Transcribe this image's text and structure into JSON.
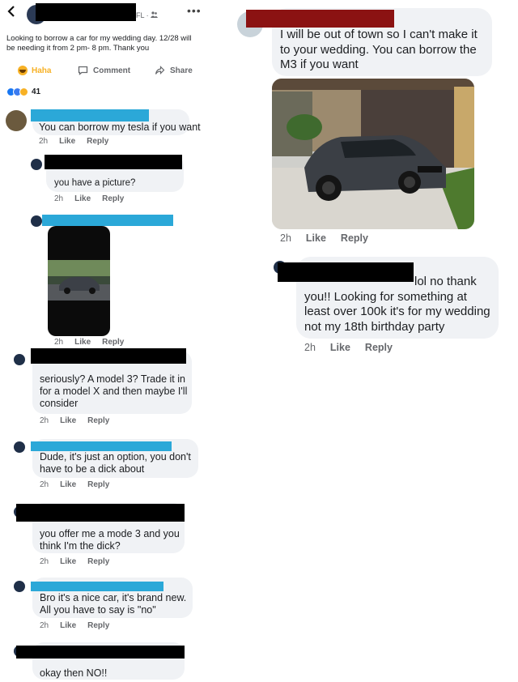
{
  "post": {
    "back_icon": "chevron-left-icon",
    "location": "FL",
    "audience_icon": "friends-icon",
    "more_icon": "more-dots-icon",
    "text": "Looking to borrow a car for my wedding day. 12/28 will\nbe needing it from 2 pm- 8 pm. Thank you",
    "actions": {
      "haha": "Haha",
      "comment": "Comment",
      "share": "Share"
    },
    "reaction_count": "41"
  },
  "comments": [
    {
      "text": "You can borrow my tesla if you want",
      "time": "2h",
      "like": "Like",
      "reply": "Reply"
    },
    {
      "text": "you have a picture?",
      "time": "2h",
      "like": "Like",
      "reply": "Reply"
    },
    {
      "text": "",
      "time": "2h",
      "like": "Like",
      "reply": "Reply"
    },
    {
      "text": "seriously? A model 3? Trade it in\nfor a model X and then maybe I'll\nconsider",
      "time": "2h",
      "like": "Like",
      "reply": "Reply"
    },
    {
      "text": "Dude, it's just an option, you don't\nhave to be a dick about",
      "time": "2h",
      "like": "Like",
      "reply": "Reply"
    },
    {
      "text": "you offer me a mode 3 and you\nthink I'm the dick?",
      "time": "2h",
      "like": "Like",
      "reply": "Reply"
    },
    {
      "text": "Bro it's a nice car, it's brand new.\nAll you have to say is \"no\"",
      "time": "2h",
      "like": "Like",
      "reply": "Reply"
    },
    {
      "text": "okay then NO!!",
      "time": "",
      "like": "",
      "reply": ""
    }
  ],
  "right_comments": [
    {
      "text": "I will be out of town so I can't make it\nto your wedding. You can borrow the\nM3 if you want",
      "time": "2h",
      "like": "Like",
      "reply": "Reply"
    },
    {
      "text": "lol no thank\nyou!! Looking for something at\nleast over 100k it's for my wedding\nnot my 18th birthday party",
      "time": "2h",
      "like": "Like",
      "reply": "Reply"
    }
  ],
  "colors": {
    "accent_blue": "#2ba8d8",
    "haha_orange": "#f7b125",
    "redaction": "#000000",
    "redaction_red": "#8b1212"
  }
}
